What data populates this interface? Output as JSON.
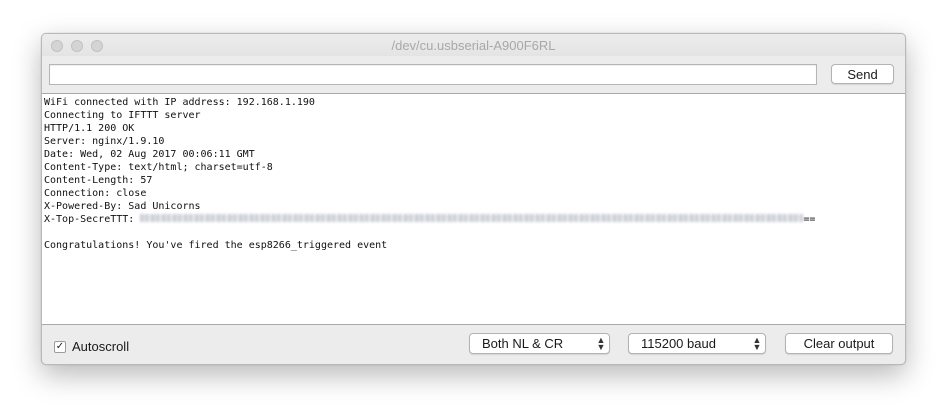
{
  "window": {
    "title": "/dev/cu.usbserial-A900F6RL"
  },
  "input": {
    "value": "",
    "send_label": "Send"
  },
  "output": {
    "lines": [
      "WiFi connected with IP address: 192.168.1.190",
      "Connecting to IFTTT server",
      "HTTP/1.1 200 OK",
      "Server: nginx/1.9.10",
      "Date: Wed, 02 Aug 2017 00:06:11 GMT",
      "Content-Type: text/html; charset=utf-8",
      "Content-Length: 57",
      "Connection: close",
      "X-Powered-By: Sad Unicorns",
      "X-Top-SecreTTT:",
      "",
      "Congratulations! You've fired the esp8266_triggered event"
    ],
    "secret_suffix": "=="
  },
  "bottom": {
    "autoscroll_label": "Autoscroll",
    "autoscroll_checked": true,
    "line_ending": "Both NL & CR",
    "baud": "115200 baud",
    "clear_label": "Clear output"
  }
}
